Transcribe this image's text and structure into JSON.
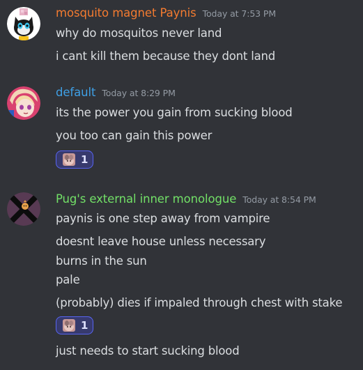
{
  "messages": [
    {
      "username": "mosquito magnet Paynis",
      "username_color": "#f47b30",
      "timestamp": "Today at 7:53 PM",
      "avatar_icon": "cat-mascot-avatar",
      "lines": [
        "why do mosquitos never land",
        "i cant kill them because they dont land"
      ]
    },
    {
      "username": "default",
      "username_color": "#3fa0e6",
      "timestamp": "Today at 8:29 PM",
      "avatar_icon": "anime-girl-avatar",
      "lines": [
        "its the power you gain from sucking blood",
        "you too can gain this power"
      ],
      "reaction": {
        "emoji_icon": "custom-emoji-icon",
        "count": "1"
      }
    },
    {
      "username": "Pug's external inner monologue",
      "username_color": "#72e067",
      "timestamp": "Today at 8:54 PM",
      "avatar_icon": "crossed-out-avatar",
      "lines": [
        "paynis is one step away from vampire",
        "doesnt leave house unless necessary",
        "burns in the sun",
        "pale",
        "(probably) dies if impaled through chest with stake",
        "just needs to start sucking blood"
      ],
      "reaction": {
        "emoji_icon": "custom-emoji-icon",
        "count": "1"
      }
    }
  ],
  "colors": {
    "background": "#313338",
    "text": "#dbdee1",
    "timestamp": "#949ba4",
    "reaction_bg": "#373a6d",
    "reaction_border": "#5865f2"
  }
}
